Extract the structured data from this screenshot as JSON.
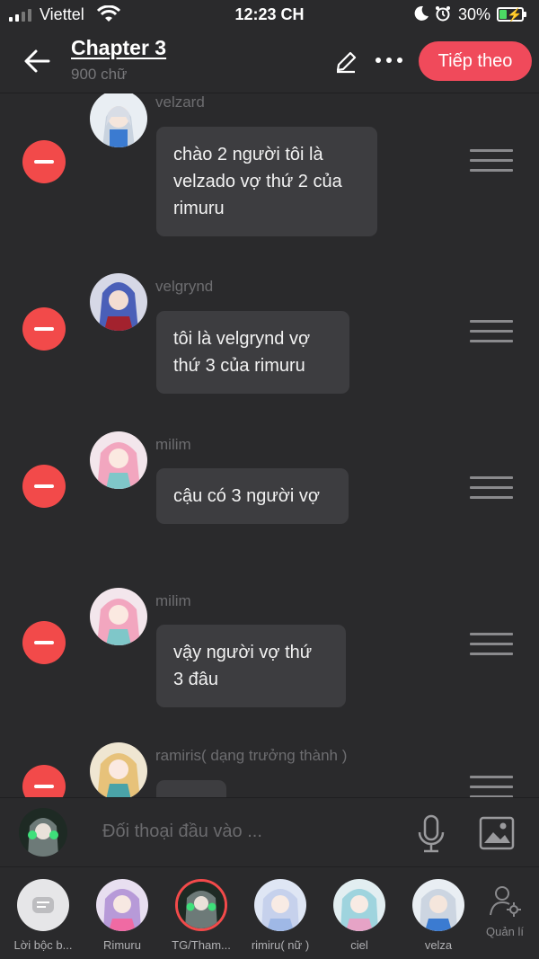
{
  "status_bar": {
    "carrier": "Viettel",
    "time": "12:23 CH",
    "battery_percent": "30%"
  },
  "header": {
    "title": "Chapter 3",
    "word_count": "900 chữ",
    "next_label": "Tiếp theo"
  },
  "messages": [
    {
      "sender": "velzard",
      "lines": [
        "chào 2 người tôi là",
        "velzado vợ thứ 2 của",
        "rimuru"
      ]
    },
    {
      "sender": "velgrynd",
      "lines": [
        "tôi là velgrynd vợ",
        "thứ 3 của rimuru"
      ]
    },
    {
      "sender": "milim",
      "lines": [
        "cậu có 3 người vợ"
      ]
    },
    {
      "sender": "milim",
      "lines": [
        "vậy người vợ thứ",
        "3 đâu"
      ]
    },
    {
      "sender": "ramiris( dạng trưởng thành )",
      "lines": [
        ""
      ]
    }
  ],
  "composer": {
    "placeholder": "Đối thoại đầu vào ..."
  },
  "characters": [
    {
      "label": "Lời bộc b...",
      "type": "narrator"
    },
    {
      "label": "Rimuru"
    },
    {
      "label": "TG/Tham...",
      "selected": true
    },
    {
      "label": "rimiru( nữ )"
    },
    {
      "label": "ciel"
    },
    {
      "label": "velza"
    }
  ],
  "manage_label": "Quản lí",
  "colors": {
    "accent": "#f04a5b",
    "remove": "#f24a4a",
    "background": "#2a2a2c",
    "bubble": "#3d3d40"
  }
}
